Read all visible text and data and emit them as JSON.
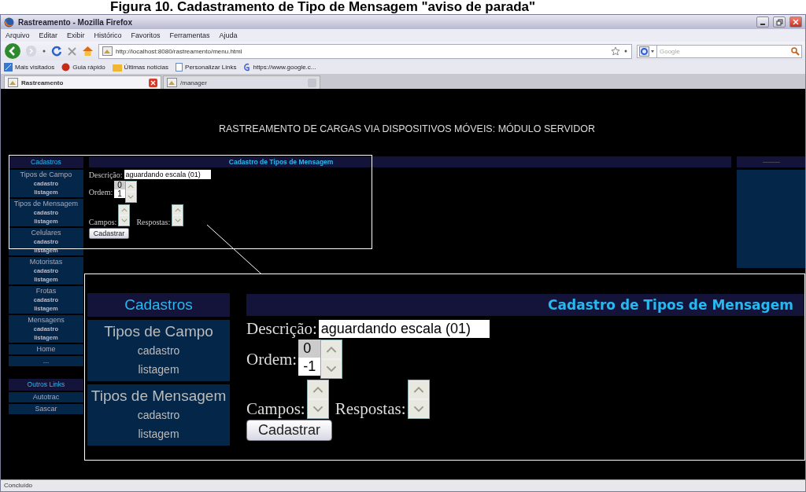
{
  "caption": "Figura 10. Cadastramento de Tipo de Mensagem \"aviso de parada\"",
  "window": {
    "title": "Rastreamento - Mozilla Firefox"
  },
  "menu": [
    "Arquivo",
    "Editar",
    "Exibir",
    "Histórico",
    "Favoritos",
    "Ferramentas",
    "Ajuda"
  ],
  "address": {
    "value": "http://localhost:8080/rastreamento/menu.html"
  },
  "search": {
    "placeholder": "Google"
  },
  "bookmarks": [
    {
      "label": "Mais visitados",
      "kind": "star"
    },
    {
      "label": "Guia rápido",
      "kind": "dot"
    },
    {
      "label": "Últimas notícias",
      "kind": "folder"
    },
    {
      "label": "Personalizar Links",
      "kind": "page"
    },
    {
      "label": "https://www.google.c...",
      "kind": "g"
    }
  ],
  "tabs": [
    {
      "label": "Rastreamento",
      "selected": true
    },
    {
      "label": "/manager",
      "selected": false
    }
  ],
  "page": {
    "heading": "RASTREAMENTO DE CARGAS VIA DISPOSITIVOS MÓVEIS: MÓDULO SERVIDOR",
    "sidebar": [
      {
        "title": "Cadastros",
        "items": [
          {
            "label": "Tipos de Campo",
            "links": [
              "cadastro",
              "listagem"
            ]
          },
          {
            "label": "Tipos de Mensagem",
            "links": [
              "cadastro",
              "listagem"
            ]
          },
          {
            "label": "Celulares",
            "links": [
              "cadastro",
              "listagem"
            ]
          },
          {
            "label": "Motoristas",
            "links": [
              "cadastro",
              "listagem"
            ]
          },
          {
            "label": "Frotas",
            "links": [
              "cadastro",
              "listagem"
            ]
          },
          {
            "label": "Mensagens",
            "links": [
              "cadastro",
              "listagem"
            ]
          },
          {
            "label": "Home"
          },
          {
            "label": "..."
          }
        ]
      },
      {
        "title": "Outros Links",
        "items": [
          {
            "label": "Autotrac"
          },
          {
            "label": "Sascar"
          }
        ]
      }
    ],
    "form": {
      "title": "Cadastro de Tipos de Mensagem",
      "description_label": "Descrição:",
      "description_value": "aguardando escala (01)",
      "order_label": "Ordem:",
      "order_options": [
        {
          "label": "0",
          "selected": true
        },
        {
          "label": "1",
          "selected": false
        }
      ],
      "fields_label": "Campos:",
      "answers_label": "Respostas:",
      "submit": "Cadastrar"
    }
  },
  "inset": {
    "sidebar": {
      "title": "Cadastros",
      "items": [
        {
          "label": "Tipos de Campo",
          "links": [
            "cadastro",
            "listagem"
          ]
        },
        {
          "label": "Tipos de Mensagem",
          "links": [
            "cadastro",
            "listagem"
          ]
        }
      ]
    },
    "form": {
      "title": "Cadastro de Tipos de Mensagem",
      "description_label": "Descrição:",
      "description_value": "aguardando escala (01)",
      "order_label": "Ordem:",
      "order_options": [
        {
          "label": "0",
          "selected": true
        },
        {
          "label": "-1",
          "selected": false
        }
      ],
      "fields_label": "Campos:",
      "answers_label": "Respostas:",
      "submit": "Cadastrar"
    }
  },
  "status_bar": "Concluído"
}
